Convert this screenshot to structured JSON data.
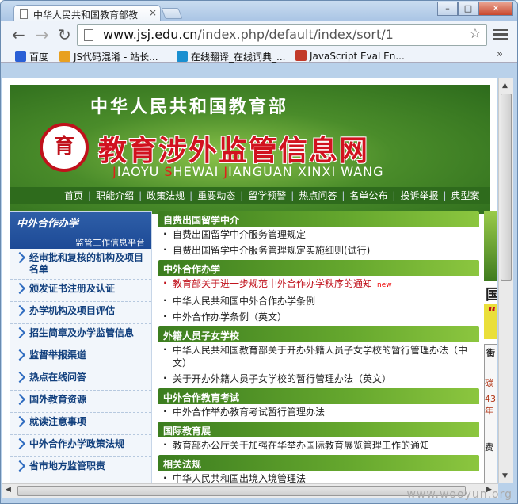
{
  "browser": {
    "tab_title": "中华人民共和国教育部教",
    "url_domain": "www.jsj.edu.cn",
    "url_path": "/index.php/default/index/sort/1",
    "bookmarks": [
      {
        "label": "百度",
        "icon": "paw-icon",
        "color": "#2a5fd6"
      },
      {
        "label": "JS代码混淆 - 站长...",
        "icon": "pencil-icon",
        "color": "#e8a020"
      },
      {
        "label": "在线翻译_在线词典_...",
        "icon": "globe-icon",
        "color": "#1a8fd0"
      },
      {
        "label": "JavaScript Eval En...",
        "icon": "js-icon",
        "color": "#c23a2a"
      }
    ],
    "more_label": "»"
  },
  "banner": {
    "title_top": "中华人民共和国教育部",
    "logo_glyph": "育",
    "title_main": "教育涉外监管信息网",
    "pinyin": [
      "J",
      "IAOYU ",
      "S",
      "HEWAI ",
      "J",
      "IANGUAN XINXI WANG"
    ]
  },
  "topnav": [
    "首页",
    "职能介绍",
    "政策法规",
    "重要动态",
    "留学预警",
    "热点问答",
    "名单公布",
    "投诉举报",
    "典型案"
  ],
  "sidebar": {
    "title": "中外合作办学",
    "subtitle": "监管工作信息平台",
    "items": [
      "经审批和复核的机构及项目名单",
      "颁发证书注册及认证",
      "办学机构及项目评估",
      "招生简章及办学监管信息",
      "监督举报渠道",
      "热点在线问答",
      "国外教育资源",
      "就读注意事项",
      "中外合作办学政策法规",
      "省市地方监管职责"
    ]
  },
  "sections": [
    {
      "heading": "自费出国留学中介",
      "items": [
        {
          "text": "自费出国留学中介服务管理规定"
        },
        {
          "text": "自费出国留学中介服务管理规定实施细则(试行)"
        }
      ]
    },
    {
      "heading": "中外合作办学",
      "items": [
        {
          "text": "教育部关于进一步规范中外合作办学秩序的通知",
          "badge": "new",
          "red": true
        },
        {
          "text": "中华人民共和国中外合作办学条例"
        },
        {
          "text": "中外合作办学条例（英文）"
        }
      ]
    },
    {
      "heading": "外籍人员子女学校",
      "items": [
        {
          "text": "中华人民共和国教育部关于开办外籍人员子女学校的暂行管理办法（中文）"
        },
        {
          "text": "关于开办外籍人员子女学校的暂行管理办法（英文）"
        }
      ]
    },
    {
      "heading": "中外合作教育考试",
      "items": [
        {
          "text": "中外合作举办教育考试暂行管理办法"
        }
      ]
    },
    {
      "heading": "国际教育展",
      "items": [
        {
          "text": "教育部办公厅关于加强在华举办国际教育展览管理工作的通知"
        }
      ]
    },
    {
      "heading": "相关法规",
      "items": [
        {
          "text": "中华人民共和国出境入境管理法"
        }
      ]
    }
  ],
  "right_strip": {
    "chars": [
      "国",
      "“",
      "街",
      "碳",
      "43",
      "年",
      "费"
    ]
  },
  "watermark": "www.wooyun.org"
}
